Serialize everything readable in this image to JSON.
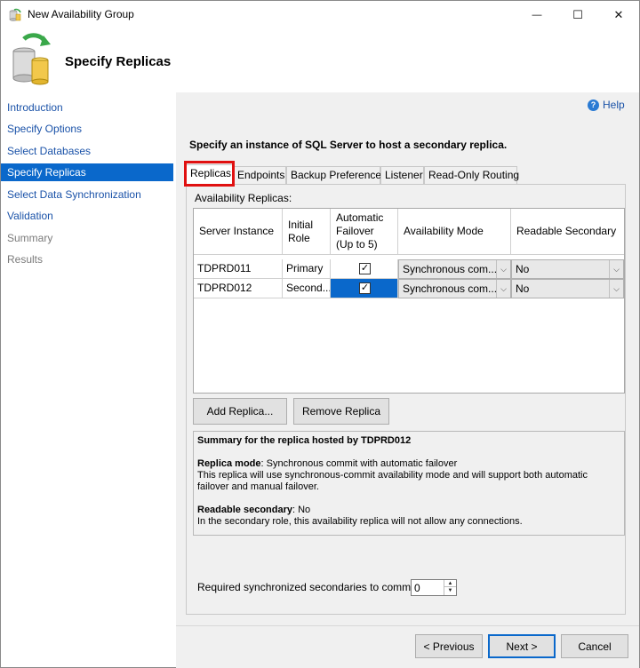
{
  "window": {
    "title": "New Availability Group",
    "minimize_glyph": "—",
    "maximize_glyph": "☐",
    "close_glyph": "✕"
  },
  "header": {
    "title": "Specify Replicas"
  },
  "sidebar": {
    "items": [
      {
        "label": "Introduction",
        "state": "link"
      },
      {
        "label": "Specify Options",
        "state": "link"
      },
      {
        "label": "Select Databases",
        "state": "link"
      },
      {
        "label": "Specify Replicas",
        "state": "selected"
      },
      {
        "label": "Select Data Synchronization",
        "state": "link"
      },
      {
        "label": "Validation",
        "state": "link"
      },
      {
        "label": "Summary",
        "state": "disabled"
      },
      {
        "label": "Results",
        "state": "disabled"
      }
    ]
  },
  "help": {
    "label": "Help"
  },
  "instruction": "Specify an instance of SQL Server to host a secondary replica.",
  "tabs": [
    {
      "label": "Replicas",
      "active": true
    },
    {
      "label": "Endpoints",
      "active": false
    },
    {
      "label": "Backup Preferences",
      "active": false
    },
    {
      "label": "Listener",
      "active": false
    },
    {
      "label": "Read-Only Routing",
      "active": false
    }
  ],
  "replicas": {
    "label": "Availability Replicas:",
    "columns": [
      "Server Instance",
      "Initial Role",
      "Automatic Failover (Up to 5)",
      "Availability Mode",
      "Readable Secondary"
    ],
    "rows": [
      {
        "server": "TDPRD011",
        "role": "Primary",
        "failover": true,
        "mode": "Synchronous com...",
        "readable": "No"
      },
      {
        "server": "TDPRD012",
        "role": "Second...",
        "failover": true,
        "mode": "Synchronous com...",
        "readable": "No"
      }
    ]
  },
  "buttons": {
    "add_replica": "Add Replica...",
    "remove_replica": "Remove Replica",
    "previous": "< Previous",
    "next": "Next >",
    "cancel": "Cancel"
  },
  "summary": {
    "title": "Summary for the replica hosted by TDPRD012",
    "mode_label": "Replica mode",
    "mode_value": ": Synchronous commit with automatic failover",
    "mode_desc": "This replica will use synchronous-commit availability mode and will support both automatic failover and manual failover.",
    "readable_label": "Readable secondary",
    "readable_value": ": No",
    "readable_desc": "In the secondary role, this availability replica will not allow any connections."
  },
  "required_sync": {
    "label": "Required synchronized secondaries to commit",
    "value": "0"
  },
  "colors": {
    "selection": "#0a68cb",
    "link": "#1a52a8",
    "tab_highlight": "#e01010",
    "panel_bg": "#f0f0f0"
  }
}
